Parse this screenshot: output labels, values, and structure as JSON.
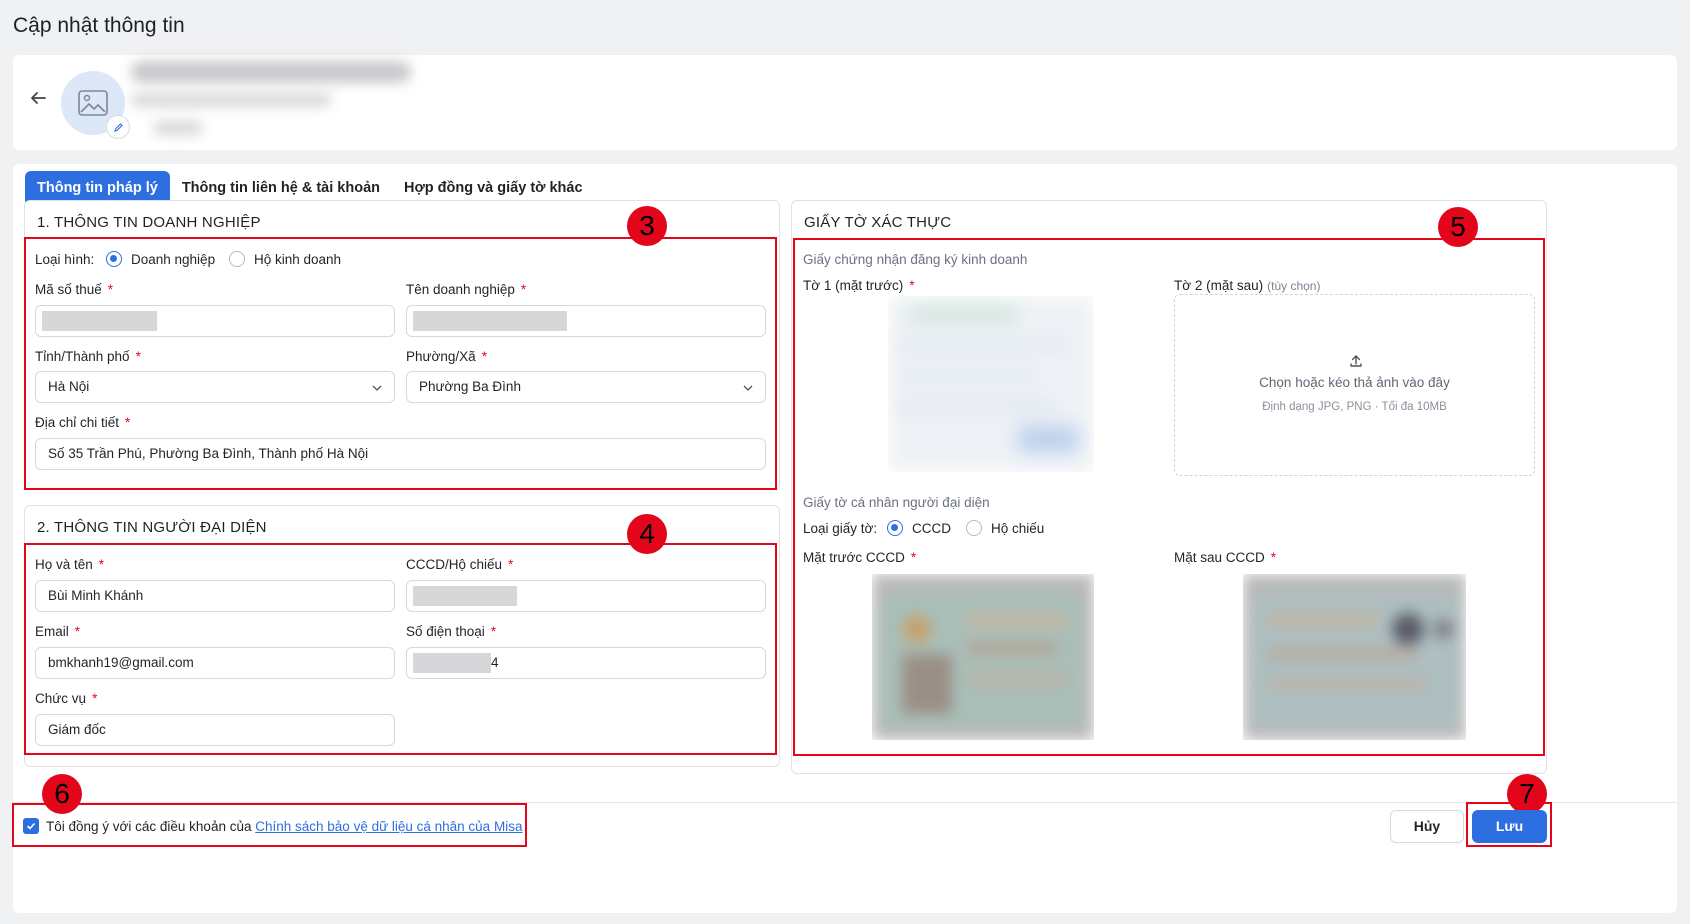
{
  "page": {
    "title": "Cập nhật thông tin"
  },
  "tabs": [
    {
      "label": "Thông tin pháp lý",
      "active": true
    },
    {
      "label": "Thông tin liên hệ & tài khoản",
      "active": false
    },
    {
      "label": "Hợp đồng và giấy tờ khác",
      "active": false
    }
  ],
  "business": {
    "title": "1. THÔNG TIN DOANH NGHIỆP",
    "type_label": "Loại hình:",
    "type_options": [
      "Doanh nghiệp",
      "Hộ kinh doanh"
    ],
    "type_selected": "Doanh nghiệp",
    "tax_code_label": "Mã số thuế",
    "company_name_label": "Tên doanh nghiệp",
    "province_label": "Tỉnh/Thành phố",
    "province_value": "Hà Nội",
    "ward_label": "Phường/Xã",
    "ward_value": "Phường Ba Đình",
    "address_label": "Địa chỉ chi tiết",
    "address_value": "Số 35 Trần Phú, Phường Ba Đình, Thành phố Hà Nội"
  },
  "representative": {
    "title": "2. THÔNG TIN NGƯỜI ĐẠI DIỆN",
    "fullname_label": "Họ và tên",
    "fullname_value": "Bùi Minh Khánh",
    "id_label": "CCCD/Hộ chiếu",
    "email_label": "Email",
    "email_value": "bmkhanh19@gmail.com",
    "phone_label": "Số điện thoại",
    "phone_suffix": "4",
    "position_label": "Chức vụ",
    "position_value": "Giám đốc"
  },
  "documents": {
    "title": "GIẤY TỜ XÁC THỰC",
    "business_cert_heading": "Giấy chứng nhận đăng ký kinh doanh",
    "sheet1_label": "Tờ 1 (mặt trước)",
    "sheet2_label": "Tờ 2 (mặt sau)",
    "sheet2_optional": "(tùy chọn)",
    "upload_text": "Chọn hoặc kéo thả ảnh vào đây",
    "upload_hint": "Định dạng JPG, PNG · Tối đa 10MB",
    "personal_heading": "Giấy tờ cá nhân người đại diện",
    "doc_type_label": "Loại giấy tờ:",
    "doc_type_options": [
      "CCCD",
      "Hộ chiếu"
    ],
    "doc_type_selected": "CCCD",
    "front_label": "Mặt trước CCCD",
    "back_label": "Mặt sau CCCD"
  },
  "footer": {
    "agree_prefix": "Tôi đồng ý với các điều khoản của",
    "agree_link": "Chính sách bảo vệ dữ liệu cá nhân của Misa",
    "agree_checked": true,
    "cancel_label": "Hủy",
    "save_label": "Lưu"
  },
  "annotations": [
    "3",
    "4",
    "5",
    "6",
    "7"
  ],
  "colors": {
    "primary": "#2d6fe0",
    "annotation": "#e3061b",
    "required": "#e3061b"
  }
}
